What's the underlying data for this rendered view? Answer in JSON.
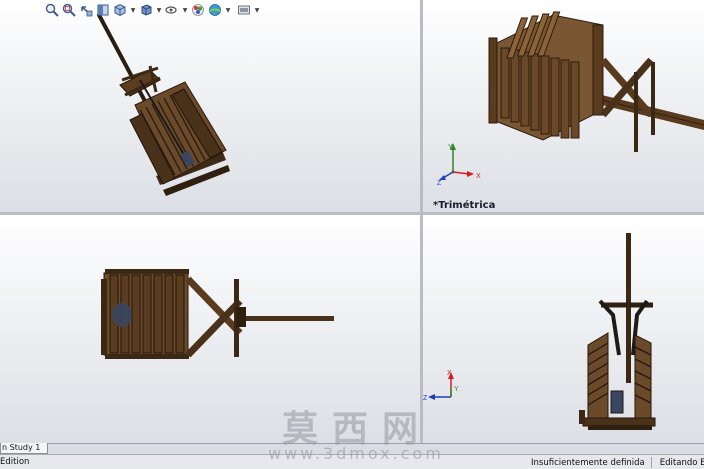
{
  "heads_up_toolbar": {
    "buttons": [
      {
        "name": "zoom-to-fit-icon"
      },
      {
        "name": "zoom-to-area-icon"
      },
      {
        "name": "previous-view-icon"
      },
      {
        "name": "section-view-icon"
      },
      {
        "name": "view-orientation-icon"
      },
      {
        "name": "display-style-icon"
      },
      {
        "name": "hide-show-items-icon"
      },
      {
        "name": "edit-appearance-icon"
      },
      {
        "name": "apply-scene-icon"
      },
      {
        "name": "view-settings-icon"
      }
    ]
  },
  "viewports": {
    "top_right": {
      "label": "*Trimétrica"
    }
  },
  "triad": {
    "x": "X",
    "y": "Y",
    "z": "Z",
    "colors": {
      "x": "#d11f1f",
      "y": "#2b8a2b",
      "z": "#1f3fbf"
    }
  },
  "tabs": {
    "study_tab": "n Study 1"
  },
  "status_bar": {
    "left": "Edition",
    "definition": "Insuficientemente definida",
    "mode": "Editando Ensar"
  },
  "watermark": {
    "cn": "莫西网",
    "url": "www.3dmox.com"
  },
  "colors": {
    "wood": "#5a3d20",
    "wood_dark": "#2f1f10",
    "frame": "#1e1a16"
  }
}
